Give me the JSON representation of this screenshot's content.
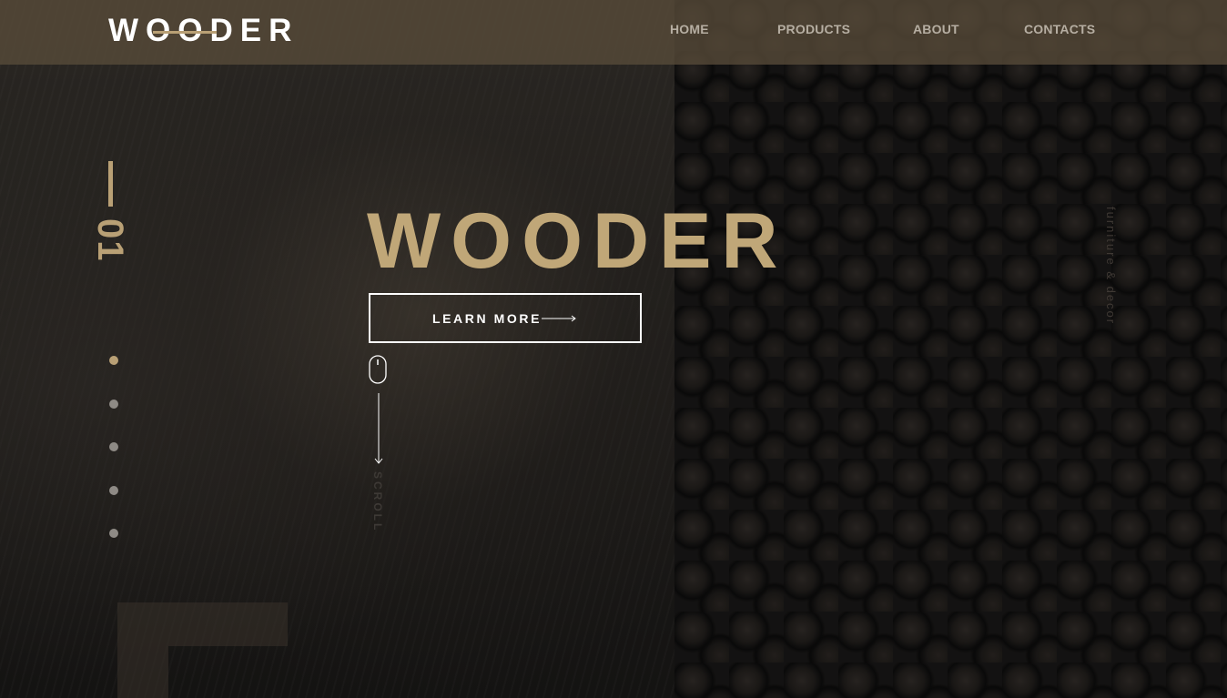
{
  "header": {
    "logo": "WOODER",
    "nav": [
      {
        "label": "HOME"
      },
      {
        "label": "PRODUCTS"
      },
      {
        "label": "ABOUT"
      },
      {
        "label": "CONTACTS"
      }
    ]
  },
  "slider": {
    "number": "01",
    "dot_count": 5,
    "active_index": 0
  },
  "hero": {
    "title": "WOODER",
    "button_label": "LEARN MORE",
    "button_icon": "arrow-right-icon"
  },
  "scroll": {
    "icon": "mouse-icon",
    "label": "SCROLL"
  },
  "tagline": "furniture & decor",
  "colors": {
    "accent": "#c0a778",
    "header_bg": "#584c3a",
    "text_light": "#ffffff",
    "nav_text": "#b6aea2"
  }
}
